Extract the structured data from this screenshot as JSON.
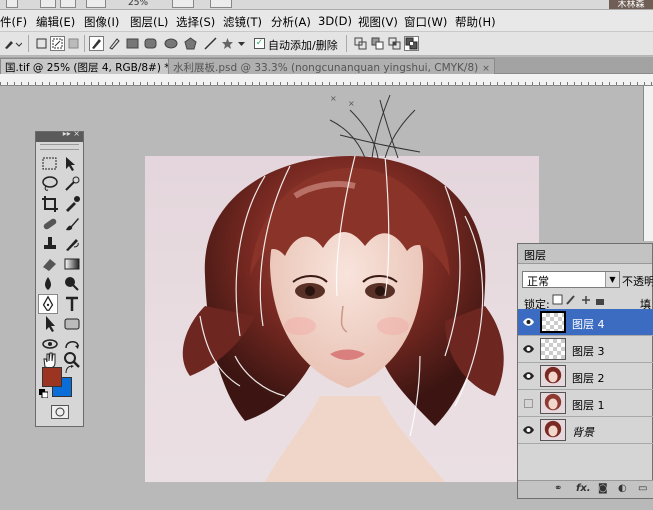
{
  "topbar": {
    "zoom": "25%",
    "brand": "木林森"
  },
  "menu": [
    {
      "label": "件(F)"
    },
    {
      "label": "编辑(E)"
    },
    {
      "label": "图像(I)"
    },
    {
      "label": "图层(L)"
    },
    {
      "label": "选择(S)"
    },
    {
      "label": "滤镜(T)"
    },
    {
      "label": "分析(A)"
    },
    {
      "label": "3D(D)"
    },
    {
      "label": "视图(V)"
    },
    {
      "label": "窗口(W)"
    },
    {
      "label": "帮助(H)"
    }
  ],
  "options": {
    "auto_add_delete_checked": true,
    "auto_add_delete_label": "自动添加/删除"
  },
  "tabs": [
    {
      "title": "国.tif @ 25% (图层 4, RGB/8#) *",
      "close": "×"
    },
    {
      "title": "水利展板.psd @ 33.3% (nongcunanquan yingshui, CMYK/8)",
      "close": "×"
    }
  ],
  "toolbox": {
    "fg_color": "#9b3420",
    "bg_color": "#0a6ed8"
  },
  "layers_panel": {
    "title": "图层",
    "blend_mode": "正常",
    "opacity_label": "不透明度",
    "lock_label": "锁定:",
    "fill_label": "填",
    "layers": [
      {
        "name": "图层 4",
        "visible": true,
        "selected": true,
        "thumb": "transparent"
      },
      {
        "name": "图层 3",
        "visible": true,
        "selected": false,
        "thumb": "transparent"
      },
      {
        "name": "图层 2",
        "visible": true,
        "selected": false,
        "thumb": "portrait"
      },
      {
        "name": "图层 1",
        "visible": false,
        "selected": false,
        "thumb": "portrait"
      },
      {
        "name": "背景",
        "visible": true,
        "selected": false,
        "thumb": "portrait",
        "italic": true
      }
    ],
    "footer_icons": [
      "link-icon",
      "fx-icon",
      "mask-icon",
      "adjustment-icon",
      "new-layer-icon"
    ]
  },
  "canvas": {
    "accent_hair": "#7a2a22",
    "skin": "#f1d4c9",
    "path_color": "#ffffff"
  }
}
